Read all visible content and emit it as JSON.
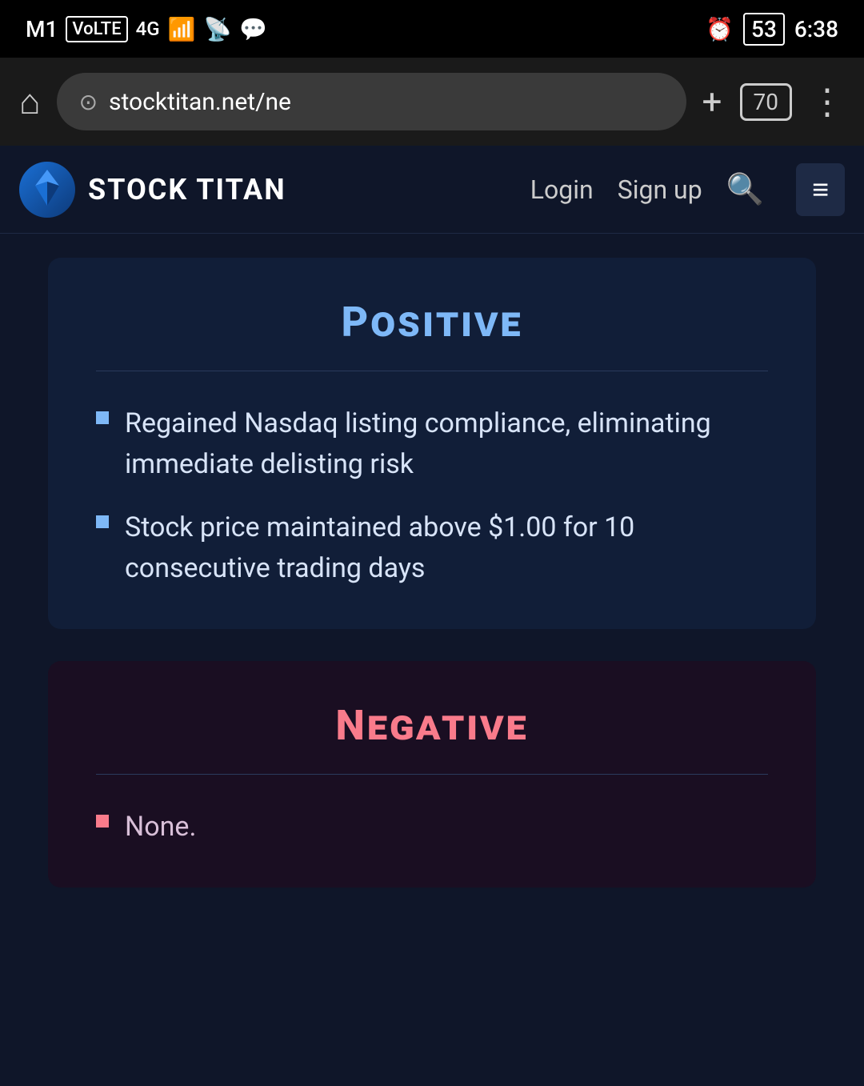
{
  "status_bar": {
    "carrier": "M1",
    "network_type": "VoLTE",
    "signal": "4G",
    "time": "6:38",
    "battery": "53",
    "alarm_icon": "⏰"
  },
  "browser": {
    "url": "stocktitan.net/ne",
    "tab_count": "70",
    "home_icon": "⌂",
    "plus_icon": "+",
    "menu_icon": "⋮"
  },
  "navbar": {
    "logo_text": "STOCK TITAN",
    "login_label": "Login",
    "signup_label": "Sign up",
    "menu_icon": "≡"
  },
  "positive_section": {
    "title": "Positive",
    "bullet1": "Regained Nasdaq listing compliance, eliminating immediate delisting risk",
    "bullet2": "Stock price maintained above $1.00 for 10 consecutive trading days"
  },
  "negative_section": {
    "title": "Negative",
    "bullet1": "None."
  }
}
